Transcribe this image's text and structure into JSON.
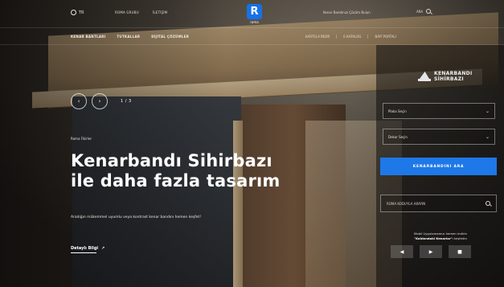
{
  "topbar": {
    "language": "TR",
    "link1": "ROMA GRUBU",
    "link2": "İLETİŞİM",
    "logo_text": "roma",
    "right_link": "Kenar Bandınızı Çözüm Bulun",
    "search_label": "ARA"
  },
  "nav": {
    "items": [
      "KENAR BANTLARI",
      "TUTKALLAR",
      "DİJİTAL ÇÖZÜMLER"
    ],
    "right_items": [
      "KARTELA İNDİR",
      "E-KATALOG",
      "BAYİ PORTALI"
    ]
  },
  "slider": {
    "prev_icon": "chevron-left-icon",
    "next_icon": "chevron-right-icon",
    "counter": "1 / 3"
  },
  "hero": {
    "eyebrow": "Roma Fikirler",
    "headline_line1": "Kenarbandı Sihirbazı",
    "headline_line2": "ile daha fazla tasarım",
    "lede": "Aradığın mükemmel uyumlu veya kontrast kenar bandını hemen keşfet!",
    "more_link": "Detaylı Bilgi"
  },
  "wizard": {
    "title_line1": "KENARBANDI",
    "title_line2": "SİHİRBAZI",
    "select1": "Plaka Seçin",
    "select2": "Dekor Seçin",
    "button": "KENARBANDINI ARA",
    "search_placeholder": "ROMA KODUYLA ARAYIN",
    "note_line1": "Mobil Uygulamamızı hemen indirin",
    "note_bold": "\"Kalıbındaki Kenarlar\"",
    "note_line2": "ı keşfedin",
    "media_icons": [
      "rewind-icon",
      "play-icon",
      "stop-icon"
    ]
  },
  "colors": {
    "brand": "#1672e6",
    "button": "#1e78e8"
  }
}
